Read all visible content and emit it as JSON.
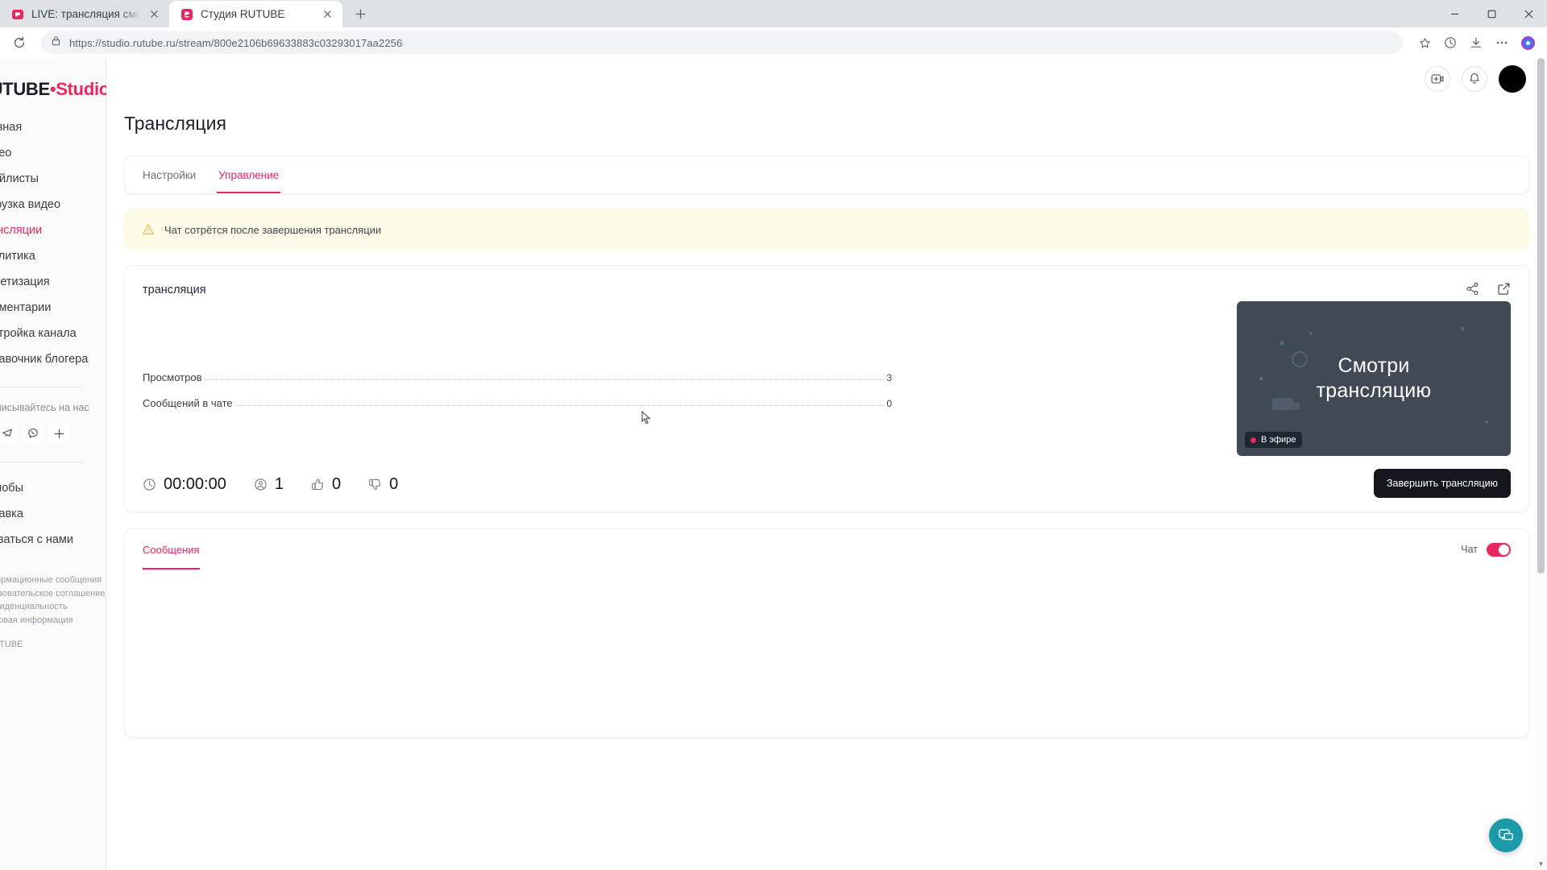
{
  "browser": {
    "tabs": [
      {
        "title": "LIVE: трансляция смотреть онла",
        "favicon": "rutube-icon",
        "active": false
      },
      {
        "title": "Студия RUTUBE",
        "favicon": "rutube-studio-icon",
        "active": true
      }
    ],
    "new_tab_label": "+",
    "window_controls": {
      "minimize": "—",
      "maximize": "❐",
      "close": "✕"
    },
    "toolbar": {
      "reload_label": "reload-icon",
      "url_prefix": "https://",
      "url_domain": "studio.rutube.ru",
      "url_path": "/stream/800e2106b69633883c03293017aa2256",
      "full_url": "https://studio.rutube.ru/stream/800e2106b69633883c03293017aa2256",
      "bookmark_label": "star-icon",
      "history_label": "history-icon",
      "download_label": "download-icon",
      "menu_label": "more-icon",
      "profile_label": "browser-profile-icon"
    }
  },
  "sidebar": {
    "logo": {
      "dark": "RUTUBE",
      "dot": "•",
      "pink": "Studio"
    },
    "nav": [
      {
        "label": "Главная",
        "active": false
      },
      {
        "label": "Видео",
        "active": false
      },
      {
        "label": "Плейлисты",
        "active": false
      },
      {
        "label": "Загрузка видео",
        "active": false
      },
      {
        "label": "Трансляции",
        "active": true
      },
      {
        "label": "Аналитика",
        "active": false
      },
      {
        "label": "Монетизация",
        "active": false
      },
      {
        "label": "Комментарии",
        "active": false
      },
      {
        "label": "Настройка канала",
        "active": false
      },
      {
        "label": "Справочник блогера",
        "active": false
      }
    ],
    "follow_title": "Подписывайтесь на нас",
    "socials": [
      {
        "name": "odnoklassniki-icon",
        "glyph": "OK"
      },
      {
        "name": "telegram-icon",
        "glyph": "TG"
      },
      {
        "name": "viber-icon",
        "glyph": "VB"
      },
      {
        "name": "more-socials-icon",
        "glyph": "+"
      }
    ],
    "nav_secondary": [
      {
        "label": "Жалобы"
      },
      {
        "label": "Справка"
      },
      {
        "label": "Связаться с нами"
      }
    ],
    "legal": [
      "Информационные сообщения",
      "Пользовательское соглашение",
      "Конфиденциальность",
      "Правовая информация",
      "© RUTUBE"
    ]
  },
  "topbar": {
    "create_label": "create-stream-icon",
    "notifications_label": "bell-icon",
    "avatar_label": "user-avatar"
  },
  "page": {
    "title": "Трансляция",
    "tabs": [
      {
        "label": "Настройки",
        "active": false
      },
      {
        "label": "Управление",
        "active": true
      }
    ],
    "alert": {
      "icon": "warning-icon",
      "text": "Чат сотрётся после завершения трансляции"
    },
    "stream": {
      "name": "трансляция",
      "share_label": "share-icon",
      "open_external_label": "external-link-icon",
      "stats": [
        {
          "label": "Просмотров",
          "value": "3"
        },
        {
          "label": "Сообщений в чате",
          "value": "0"
        }
      ],
      "metrics": [
        {
          "icon": "clock-icon",
          "value": "00:00:00"
        },
        {
          "icon": "viewers-icon",
          "value": "1"
        },
        {
          "icon": "thumb-up-icon",
          "value": "0"
        },
        {
          "icon": "thumb-down-icon",
          "value": "0"
        }
      ],
      "preview": {
        "line1": "Смотри",
        "line2": "трансляцию",
        "badge": "В эфире"
      },
      "end_button": "Завершить трансляцию"
    },
    "chat": {
      "tab_label": "Сообщения",
      "toggle_label": "Чат",
      "toggle_on": true
    },
    "support_fab": "support-chat-icon"
  },
  "colors": {
    "accent": "#e8275e",
    "alert_bg": "#fdfbe8",
    "preview_bg": "#3f4a55",
    "fab": "#1b9aaa",
    "dark_button": "#16161f"
  }
}
